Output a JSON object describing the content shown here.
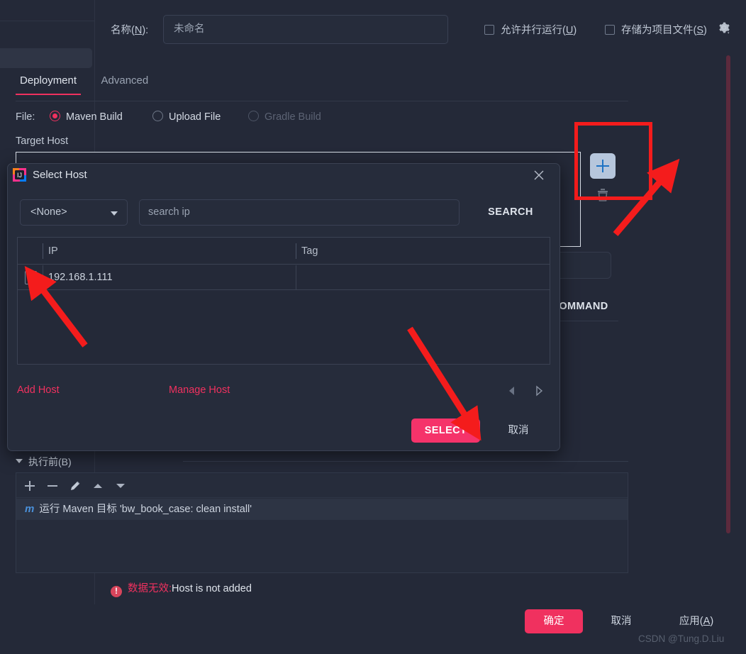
{
  "window": {
    "name_label": "名称(N):",
    "name_value": "未命名",
    "parallel_checkbox": "允许并行运行(U)",
    "store_project_checkbox": "存储为项目文件(S)",
    "gear_icon": "gear-icon"
  },
  "tabs": [
    {
      "label": "Deployment",
      "active": true
    },
    {
      "label": "Advanced",
      "active": false
    }
  ],
  "file_row": {
    "label": "File:",
    "options": [
      {
        "label": "Maven Build",
        "selected": true,
        "disabled": false
      },
      {
        "label": "Upload File",
        "selected": false,
        "disabled": false
      },
      {
        "label": "Gradle Build",
        "selected": false,
        "disabled": true
      }
    ]
  },
  "target_host": {
    "label": "Target Host",
    "add_icon": "plus-icon",
    "delete_icon": "trash-icon",
    "select_command_label": "SELECT COMMAND"
  },
  "before_launch": {
    "header": "执行前(B)",
    "toolbar_icons": [
      "plus-icon",
      "minus-icon",
      "pencil-icon",
      "arrow-up-icon",
      "arrow-down-icon"
    ],
    "task_badge": "m",
    "task_text": "运行 Maven 目标 'bw_book_case: clean install'"
  },
  "error": {
    "icon": "error-icon",
    "key": "数据无效:",
    "value": "Host is not added"
  },
  "bottom_bar": {
    "ok": "确定",
    "cancel": "取消",
    "apply": "应用(A)",
    "watermark": "CSDN @Tung.D.Liu"
  },
  "dialog": {
    "title": "Select Host",
    "app_icon": "intellij-idea-icon",
    "close_icon": "close-icon",
    "filter_value": "<None>",
    "search_placeholder": "search ip",
    "search_button": "SEARCH",
    "table": {
      "columns": [
        "IP",
        "Tag"
      ],
      "rows": [
        {
          "checked": false,
          "ip": "192.168.1.111",
          "tag": ""
        }
      ]
    },
    "add_host": "Add Host",
    "manage_host": "Manage Host",
    "prev_icon": "triangle-left-icon",
    "next_icon": "triangle-right-icon",
    "select_button": "SELECT",
    "cancel_button": "取消"
  },
  "colors": {
    "accent_pink": "#f0315f",
    "dialog_button_pink": "#f5336a",
    "annotation_red": "#f41c1c",
    "background": "#242938",
    "panel": "#262c3b",
    "plus_button_bg": "#b6c6dc",
    "plus_glyph": "#1d72c4"
  }
}
